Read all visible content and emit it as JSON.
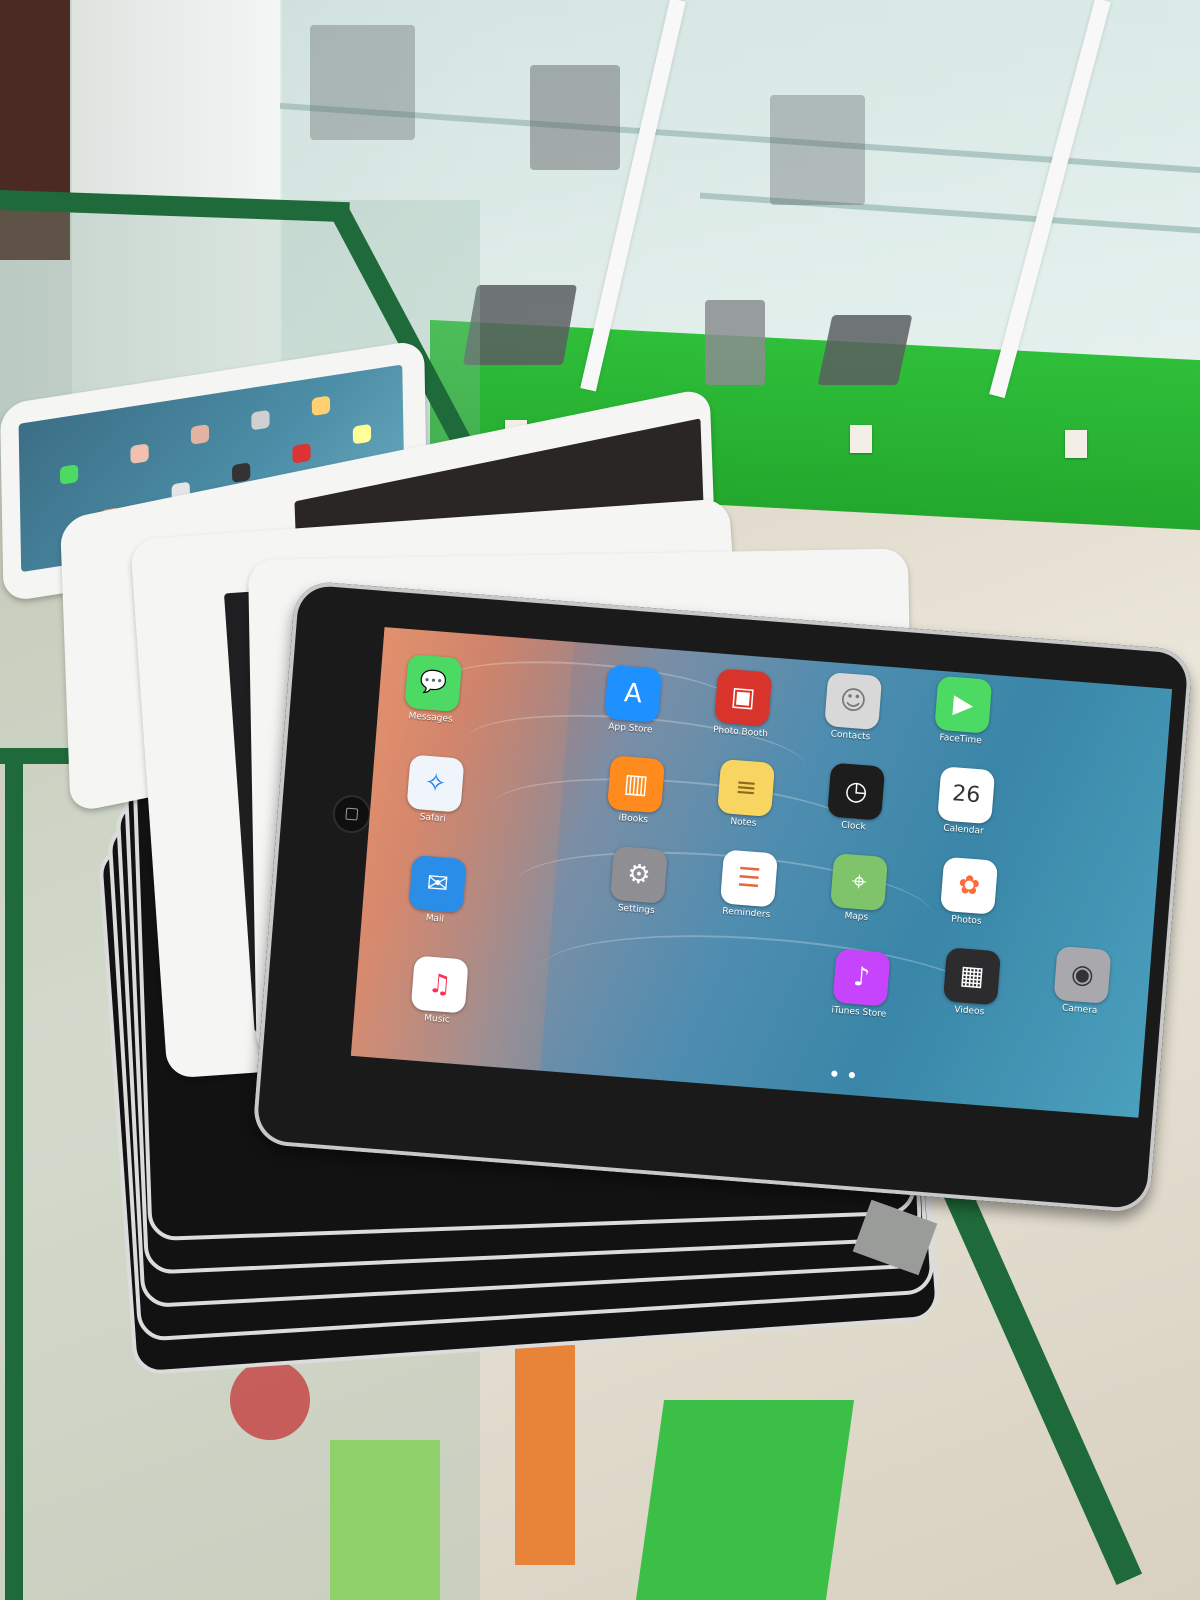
{
  "scene": {
    "description_free": true,
    "colors": {
      "store_green": "#23a82d",
      "counter_rail": "#1f6a3a",
      "bezel_black": "#1a1a1b",
      "bezel_white": "#f5f5f3",
      "wallpaper_blue": "#3a86a8",
      "wallpaper_orange": "#d08a6c"
    }
  },
  "home_screen": {
    "apps": [
      {
        "label": "Messages",
        "icon": "messages-icon",
        "color": "#4cd964",
        "glyph": "💬"
      },
      {
        "label": "App Store",
        "icon": "app-store-icon",
        "color": "#1e90ff",
        "glyph": "A"
      },
      {
        "label": "Photo Booth",
        "icon": "photo-booth-icon",
        "color": "#d9342b",
        "glyph": "▣"
      },
      {
        "label": "Contacts",
        "icon": "contacts-icon",
        "color": "#b9b9b9",
        "glyph": "☺"
      },
      {
        "label": "FaceTime",
        "icon": "facetime-icon",
        "color": "#4cd964",
        "glyph": "▶"
      },
      {
        "label": "Safari",
        "icon": "safari-icon",
        "color": "#f0f5fb",
        "glyph": "✧"
      },
      {
        "label": "iBooks",
        "icon": "ibooks-icon",
        "color": "#ff8a1e",
        "glyph": "▥"
      },
      {
        "label": "Notes",
        "icon": "notes-icon",
        "color": "#f8d561",
        "glyph": "≡"
      },
      {
        "label": "Clock",
        "icon": "clock-icon",
        "color": "#1d1d1d",
        "glyph": "◷"
      },
      {
        "label": "Calendar",
        "icon": "calendar-icon",
        "color": "#ffffff",
        "glyph": "26"
      },
      {
        "label": "Mail",
        "icon": "mail-icon",
        "color": "#2a8ee8",
        "glyph": "✉"
      },
      {
        "label": "Settings",
        "icon": "settings-icon",
        "color": "#8e8e93",
        "glyph": "⚙"
      },
      {
        "label": "Reminders",
        "icon": "reminders-icon",
        "color": "#ffffff",
        "glyph": "☰"
      },
      {
        "label": "Maps",
        "icon": "maps-icon",
        "color": "#7fc46a",
        "glyph": "⌖"
      },
      {
        "label": "Photos",
        "icon": "photos-icon",
        "color": "#ffffff",
        "glyph": "✿"
      },
      {
        "label": "Music",
        "icon": "music-icon",
        "color": "#ff2d55",
        "glyph": "♫"
      },
      {
        "label": "iTunes Store",
        "icon": "itunes-store-icon",
        "color": "#c644fc",
        "glyph": "♪"
      },
      {
        "label": "Videos",
        "icon": "videos-icon",
        "color": "#2c2c2e",
        "glyph": "▦"
      },
      {
        "label": "Camera",
        "icon": "camera-icon",
        "color": "#a8a8ad",
        "glyph": "◉"
      }
    ]
  }
}
